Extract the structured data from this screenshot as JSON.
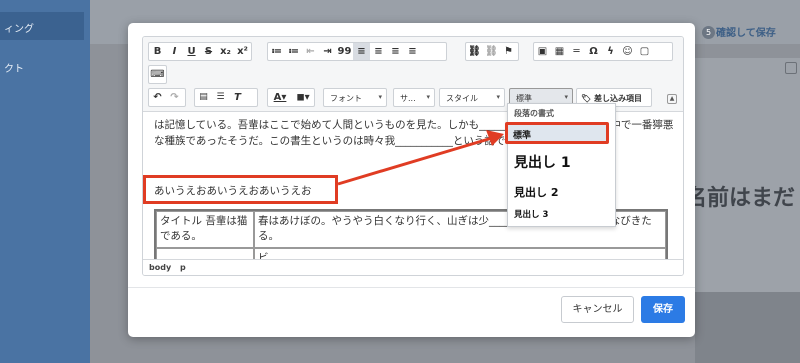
{
  "background": {
    "nav_items": [
      "ィング",
      "クト"
    ],
    "badge_count": "5",
    "top_button": "確認して保存",
    "panel_title": "名前はまだ"
  },
  "toolbar": {
    "row1": [
      "B",
      "I",
      "U",
      "S",
      "x₂",
      "x²",
      "≔",
      "≔",
      "⇤",
      "⇥",
      "99",
      "≡",
      "≡",
      "≡",
      "≡",
      "⛓",
      "⛓",
      "⚑",
      "▣",
      "▦",
      "═",
      "Ω",
      "ϟ",
      "☺",
      "▢"
    ],
    "row1b": [
      "⌨"
    ],
    "undo": "↶",
    "redo": "↷",
    "font_label": "フォント",
    "size_label": "サ...",
    "style_label": "スタイル",
    "format_label": "標準",
    "insert_label": "差し込み項目"
  },
  "content": {
    "paragraph1": "は記憶している。吾輩はここで始めて人間というものを見た。しかも___________書生という人間中で一番獰悪な種族であったそうだ。この書生というのは時々我___________という話である。",
    "paragraph2": "あいうえおあいうえおあいうえお",
    "table": {
      "r1c1": "タイトル 吾輩は猫である。",
      "r1c2": "春はあけぼの。やうやう白くなり行く、山ぎは少___________る雲の細くたなびきたる。",
      "r2c2": "ビ... ..."
    },
    "status_path": [
      "body",
      "p"
    ]
  },
  "dropdown": {
    "header": "段落の書式",
    "selected": "標準",
    "items": [
      "見出し 1",
      "見出し 2",
      "見出し 3"
    ]
  },
  "footer": {
    "cancel": "キャンセル",
    "save": "保存"
  },
  "colors": {
    "annotation": "#e03c23",
    "primary": "#2c7be5",
    "sidebar": "#4a73a3"
  }
}
